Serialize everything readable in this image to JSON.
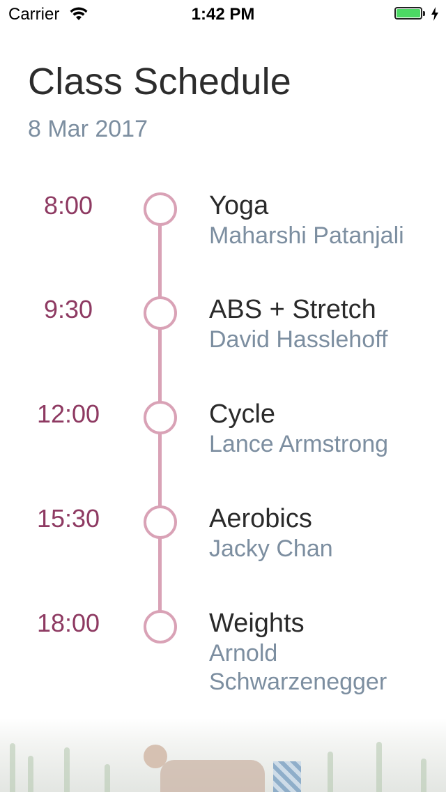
{
  "status_bar": {
    "carrier": "Carrier",
    "time": "1:42 PM",
    "battery_color": "#4cd964"
  },
  "header": {
    "title": "Class Schedule",
    "date": "8 Mar 2017"
  },
  "colors": {
    "time_color": "#8e3a62",
    "timeline_color": "#d9a2b6",
    "instructor_color": "#7c8ea0",
    "title_color": "#2c2c2c"
  },
  "schedule": [
    {
      "time": "8:00",
      "class_name": "Yoga",
      "instructor": "Maharshi Patanjali"
    },
    {
      "time": "9:30",
      "class_name": "ABS + Stretch",
      "instructor": "David Hasslehoff"
    },
    {
      "time": "12:00",
      "class_name": "Cycle",
      "instructor": "Lance Armstrong"
    },
    {
      "time": "15:30",
      "class_name": "Aerobics",
      "instructor": "Jacky Chan"
    },
    {
      "time": "18:00",
      "class_name": "Weights",
      "instructor": "Arnold Schwarzenegger"
    }
  ]
}
